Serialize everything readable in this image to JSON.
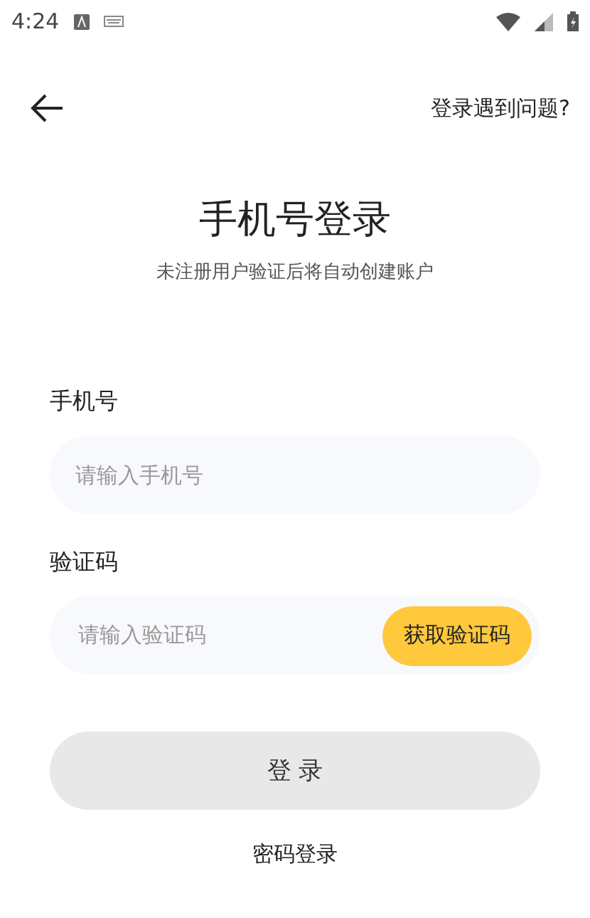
{
  "status_bar": {
    "time": "4:24"
  },
  "header": {
    "help_link": "登录遇到问题?"
  },
  "title": "手机号登录",
  "subtitle": "未注册用户验证后将自动创建账户",
  "fields": [
    {
      "kind": "plain",
      "label": "手机号",
      "placeholder": "请输入手机号"
    },
    {
      "kind": "code",
      "label": "验证码",
      "placeholder": "请输入验证码",
      "action": "获取验证码"
    }
  ],
  "login_button": {
    "label": "登 录",
    "disabled": true
  },
  "alt_login": "密码登录"
}
